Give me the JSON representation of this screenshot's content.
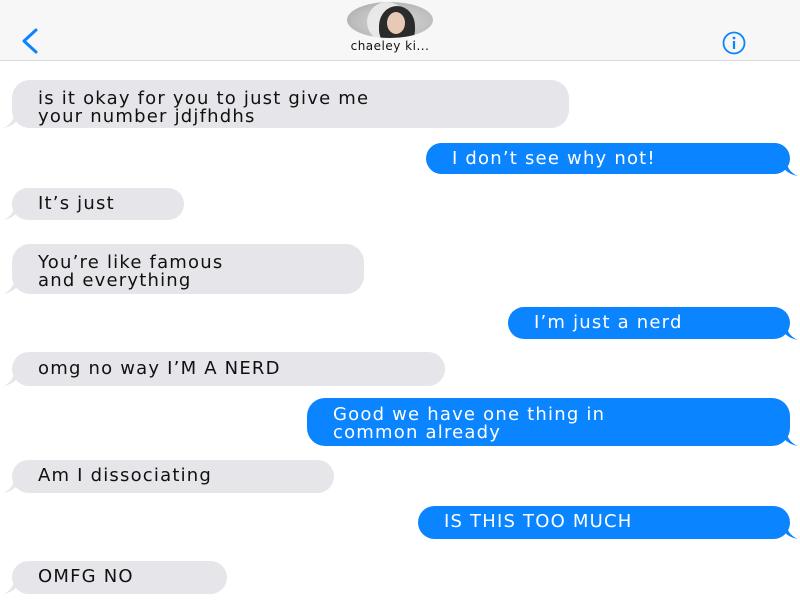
{
  "header": {
    "contact_name": "chaeley ki...",
    "back_icon": "chevron-left-icon",
    "info_icon": "info-icon",
    "accent_color": "#0a84ff"
  },
  "messages": [
    {
      "from": "them",
      "text": "is it okay for you to just give me\nyour number jdjfhdhs"
    },
    {
      "from": "me",
      "text": "I don’t see why not!"
    },
    {
      "from": "them",
      "text": "It’s just"
    },
    {
      "from": "them",
      "text": "You’re like famous\nand everything"
    },
    {
      "from": "me",
      "text": "I’m just a nerd"
    },
    {
      "from": "them",
      "text": "omg no way I’M A NERD"
    },
    {
      "from": "me",
      "text": "Good we have one thing in\ncommon already"
    },
    {
      "from": "them",
      "text": "Am I dissociating"
    },
    {
      "from": "me",
      "text": "IS THIS TOO MUCH"
    },
    {
      "from": "them",
      "text": "OMFG NO"
    }
  ]
}
